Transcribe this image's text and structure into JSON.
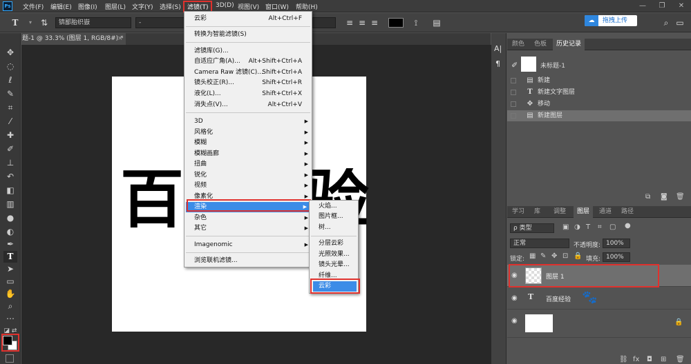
{
  "app": {
    "logo": "Ps"
  },
  "menubar": {
    "items": [
      "文件(F)",
      "编辑(E)",
      "图像(I)",
      "图层(L)",
      "文字(Y)",
      "选择(S)",
      "滤镜(T)",
      "3D(D)",
      "视图(V)",
      "窗口(W)",
      "帮助(H)"
    ],
    "window_controls": [
      "—",
      "❐",
      "✕"
    ]
  },
  "options": {
    "font_family": "锛鄙胎织嶽",
    "font_style": "-",
    "font_size": "",
    "aa_mode": "",
    "upload_label": "拖拽上传",
    "text_color": "#000000"
  },
  "document": {
    "tab_title": "题-1 @ 33.3% (图层 1, RGB/8#) *",
    "close": "×",
    "canvas_text_left": "百",
    "canvas_text_right": "验"
  },
  "filter_menu": {
    "items": [
      {
        "label": "云彩",
        "shortcut": "Alt+Ctrl+F"
      },
      {
        "label": "转换为智能滤镜(S)",
        "shortcut": ""
      },
      {
        "label": "滤镜库(G)...",
        "shortcut": ""
      },
      {
        "label": "自适应广角(A)...",
        "shortcut": "Alt+Shift+Ctrl+A"
      },
      {
        "label": "Camera Raw 滤镜(C)...",
        "shortcut": "Shift+Ctrl+A"
      },
      {
        "label": "镜头校正(R)...",
        "shortcut": "Shift+Ctrl+R"
      },
      {
        "label": "液化(L)...",
        "shortcut": "Shift+Ctrl+X"
      },
      {
        "label": "消失点(V)...",
        "shortcut": "Alt+Ctrl+V"
      },
      {
        "label": "3D",
        "shortcut": ""
      },
      {
        "label": "风格化",
        "shortcut": ""
      },
      {
        "label": "模糊",
        "shortcut": ""
      },
      {
        "label": "模糊画廊",
        "shortcut": ""
      },
      {
        "label": "扭曲",
        "shortcut": ""
      },
      {
        "label": "锐化",
        "shortcut": ""
      },
      {
        "label": "视频",
        "shortcut": ""
      },
      {
        "label": "像素化",
        "shortcut": ""
      },
      {
        "label": "渲染",
        "shortcut": ""
      },
      {
        "label": "杂色",
        "shortcut": ""
      },
      {
        "label": "其它",
        "shortcut": ""
      },
      {
        "label": "Imagenomic",
        "shortcut": ""
      },
      {
        "label": "浏览联机滤镜...",
        "shortcut": ""
      }
    ],
    "submenu_arrow": "▶"
  },
  "render_submenu": {
    "items": [
      "火焰...",
      "图片框...",
      "树...",
      "分层云彩",
      "光照效果...",
      "镜头光晕...",
      "纤维...",
      "云彩"
    ]
  },
  "history_panel": {
    "tabs": [
      "颜色",
      "色板",
      "历史记录"
    ],
    "snapshot_name": "未标题-1",
    "states": [
      "新建",
      "新建文字图层",
      "移动",
      "新建图层"
    ]
  },
  "layers_panel": {
    "tabs": [
      "学习",
      "库",
      "调整",
      "图层",
      "通道",
      "路径"
    ],
    "filter_kind": "ρ 类型",
    "blend_mode": "正常",
    "opacity_label": "不透明度:",
    "opacity_value": "100%",
    "lock_label": "锁定:",
    "fill_label": "填充:",
    "fill_value": "100%",
    "layers": [
      {
        "name": "图层 1"
      },
      {
        "name": "百度经验"
      },
      {
        "name": ""
      }
    ]
  },
  "colors": {
    "highlight": "#3c8ce7",
    "annotation_red": "#e0312d"
  }
}
